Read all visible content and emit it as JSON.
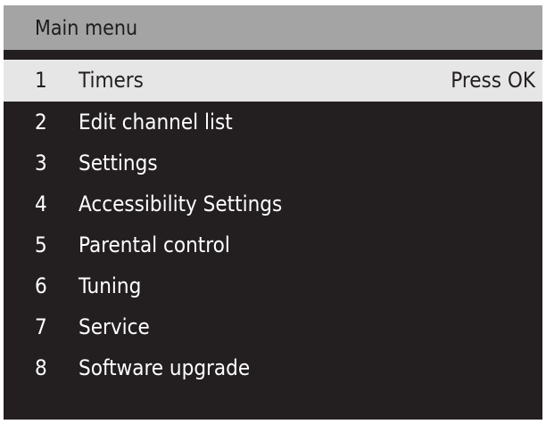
{
  "header": {
    "title": "Main menu"
  },
  "menu": {
    "selected_index": 0,
    "items": [
      {
        "number": "1",
        "label": "Timers",
        "hint": "Press OK"
      },
      {
        "number": "2",
        "label": "Edit channel list"
      },
      {
        "number": "3",
        "label": "Settings"
      },
      {
        "number": "4",
        "label": "Accessibility Settings"
      },
      {
        "number": "5",
        "label": "Parental control"
      },
      {
        "number": "6",
        "label": "Tuning"
      },
      {
        "number": "7",
        "label": "Service"
      },
      {
        "number": "8",
        "label": "Software upgrade"
      }
    ]
  },
  "colors": {
    "background": "#231f20",
    "header": "#a4a4a4",
    "selected_row": "#e6e6e6",
    "text": "#ffffff",
    "selected_text": "#231f20"
  }
}
